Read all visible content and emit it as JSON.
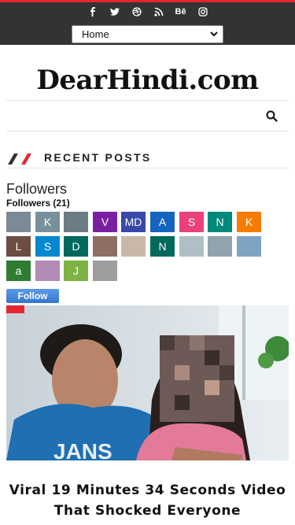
{
  "header": {
    "social_icons": [
      "facebook-icon",
      "twitter-icon",
      "dribbble-icon",
      "rss-icon",
      "behance-icon",
      "instagram-icon"
    ],
    "behance_label": "Bē",
    "menu": {
      "selected": "Home"
    }
  },
  "site": {
    "logo_text": "DearHindi.com"
  },
  "recent_posts": {
    "heading": "RECENT POSTS"
  },
  "followers_widget": {
    "title": "Followers",
    "count_label": "Followers (21)",
    "follow_button": "Follow",
    "tiles": [
      {
        "label": "",
        "color": "#7a8a96"
      },
      {
        "label": "K",
        "color": "#78909c"
      },
      {
        "label": "",
        "color": "#6d7b84"
      },
      {
        "label": "V",
        "color": "#7b1fa2"
      },
      {
        "label": "MD",
        "color": "#3949ab"
      },
      {
        "label": "A",
        "color": "#1565c0"
      },
      {
        "label": "S",
        "color": "#ec407a"
      },
      {
        "label": "N",
        "color": "#00897b"
      },
      {
        "label": "K",
        "color": "#f57c00"
      },
      {
        "label": "L",
        "color": "#6d4c41"
      },
      {
        "label": "S",
        "color": "#0288d1"
      },
      {
        "label": "D",
        "color": "#00695c"
      },
      {
        "label": "",
        "color": "#8d6e63"
      },
      {
        "label": "",
        "color": "#c9b8a8"
      },
      {
        "label": "N",
        "color": "#00695c"
      },
      {
        "label": "",
        "color": "#b0bec5"
      },
      {
        "label": "",
        "color": "#90a4ae"
      },
      {
        "label": "",
        "color": "#7fa3c3"
      },
      {
        "label": "a",
        "color": "#2e7d32"
      },
      {
        "label": "",
        "color": "#b38bb5"
      },
      {
        "label": "J",
        "color": "#7cb342"
      },
      {
        "label": "",
        "color": "#9e9e9e"
      }
    ]
  },
  "featured_post": {
    "headline": "Viral 19 Minutes 34 Seconds Video That Shocked Everyone"
  },
  "colors": {
    "accent": "#e3262e",
    "topbar": "#333333",
    "follow": "#3576cf"
  }
}
